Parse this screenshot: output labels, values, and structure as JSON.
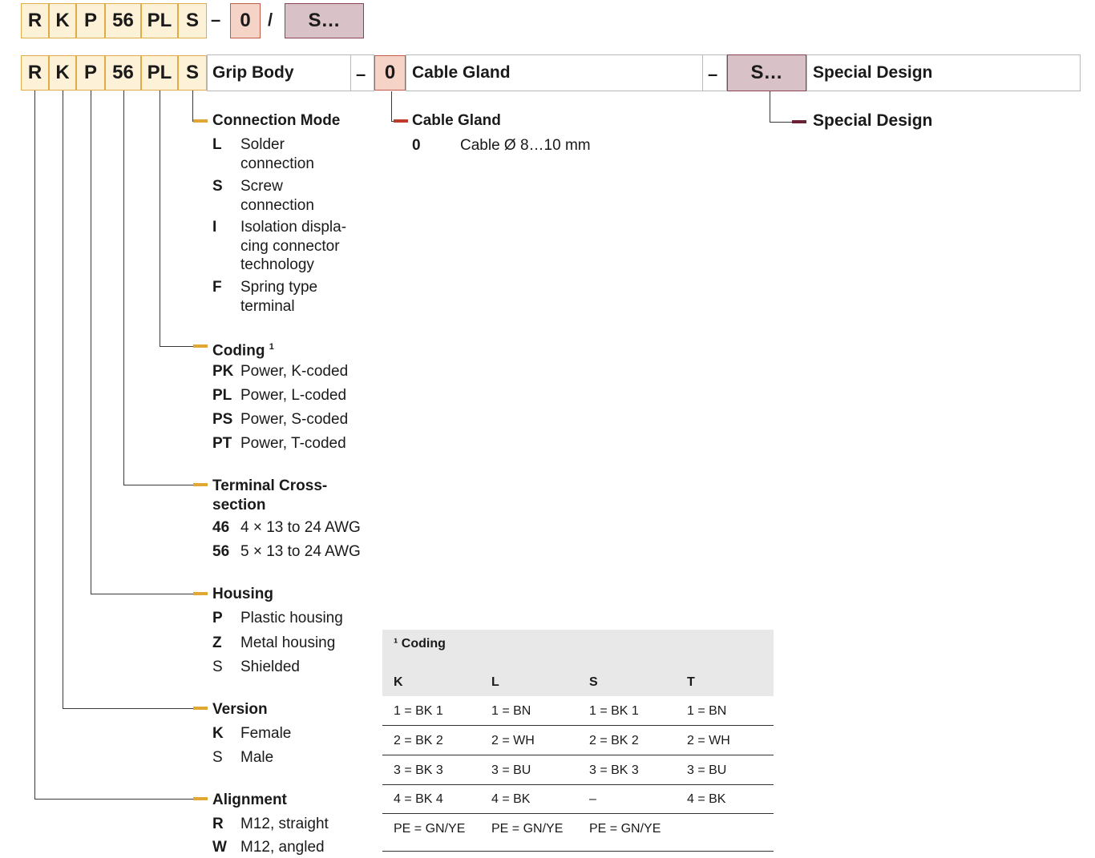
{
  "top_code": {
    "boxes": [
      "R",
      "K",
      "P",
      "56",
      "PL",
      "S",
      "0",
      "S…"
    ],
    "dash": "–",
    "slash": "/"
  },
  "header": {
    "boxes": [
      "R",
      "K",
      "P",
      "56",
      "PL",
      "S"
    ],
    "grip_body_label": "Grip Body",
    "dash1": "–",
    "cable_code": "0",
    "cable_label": "Cable Gland",
    "dash2": "–",
    "special_code": "S…",
    "special_label": "Special Design"
  },
  "connection_mode": {
    "title": "Connection Mode",
    "items": [
      {
        "code": "L",
        "desc": "Solder\nconnection"
      },
      {
        "code": "S",
        "desc": "Screw\nconnection"
      },
      {
        "code": "I",
        "desc": "Isolation displa-\ncing connector\ntechnology"
      },
      {
        "code": "F",
        "desc": "Spring type\nterminal"
      }
    ]
  },
  "coding": {
    "title": "Coding",
    "footnote_mark": "1",
    "items": [
      {
        "code": "PK",
        "desc": "Power, K-coded"
      },
      {
        "code": "PL",
        "desc": "Power, L-coded"
      },
      {
        "code": "PS",
        "desc": "Power, S-coded"
      },
      {
        "code": "PT",
        "desc": "Power, T-coded"
      }
    ]
  },
  "terminal": {
    "title": "Terminal Cross-\nsection",
    "items": [
      {
        "code": "46",
        "desc": "4 × 13 to 24 AWG"
      },
      {
        "code": "56",
        "desc": "5 × 13 to 24 AWG"
      }
    ]
  },
  "housing": {
    "title": "Housing",
    "items": [
      {
        "code": "P",
        "desc": "Plastic housing"
      },
      {
        "code": "Z",
        "desc": "Metal housing"
      },
      {
        "code": "S",
        "desc": "Shielded"
      }
    ]
  },
  "version": {
    "title": "Version",
    "items": [
      {
        "code": "K",
        "desc": "Female"
      },
      {
        "code": "S",
        "desc": "Male"
      }
    ]
  },
  "alignment": {
    "title": "Alignment",
    "items": [
      {
        "code": "R",
        "desc": "M12, straight"
      },
      {
        "code": "W",
        "desc": "M12, angled"
      }
    ]
  },
  "cable_gland": {
    "title": "Cable Gland",
    "items": [
      {
        "code": "0",
        "desc": "Cable Ø 8…10 mm"
      }
    ]
  },
  "special_design": {
    "title": "Special Design"
  },
  "coding_table": {
    "title": "¹ Coding",
    "headers": [
      "K",
      "L",
      "S",
      "T"
    ],
    "rows": [
      [
        "1 = BK 1",
        "1 = BN",
        "1 = BK 1",
        "1 = BN"
      ],
      [
        "2 = BK 2",
        "2 = WH",
        "2 = BK 2",
        "2 = WH"
      ],
      [
        "3 = BK 3",
        "3 = BU",
        "3 = BK 3",
        "3 = BU"
      ],
      [
        "4 = BK 4",
        "4 = BK",
        "–",
        "4 = BK"
      ],
      [
        "PE = GN/YE",
        "PE = GN/YE",
        "PE = GN/YE",
        ""
      ]
    ]
  },
  "colors": {
    "code_yellow_fill": "#fdf1d8",
    "code_yellow_border": "#e0ac45",
    "cable_fill": "#f6d3c7",
    "special_fill": "#d8c2c7",
    "marker_yellow": "#e0a733",
    "marker_red": "#c0392b",
    "marker_maroon": "#6d1f34"
  }
}
